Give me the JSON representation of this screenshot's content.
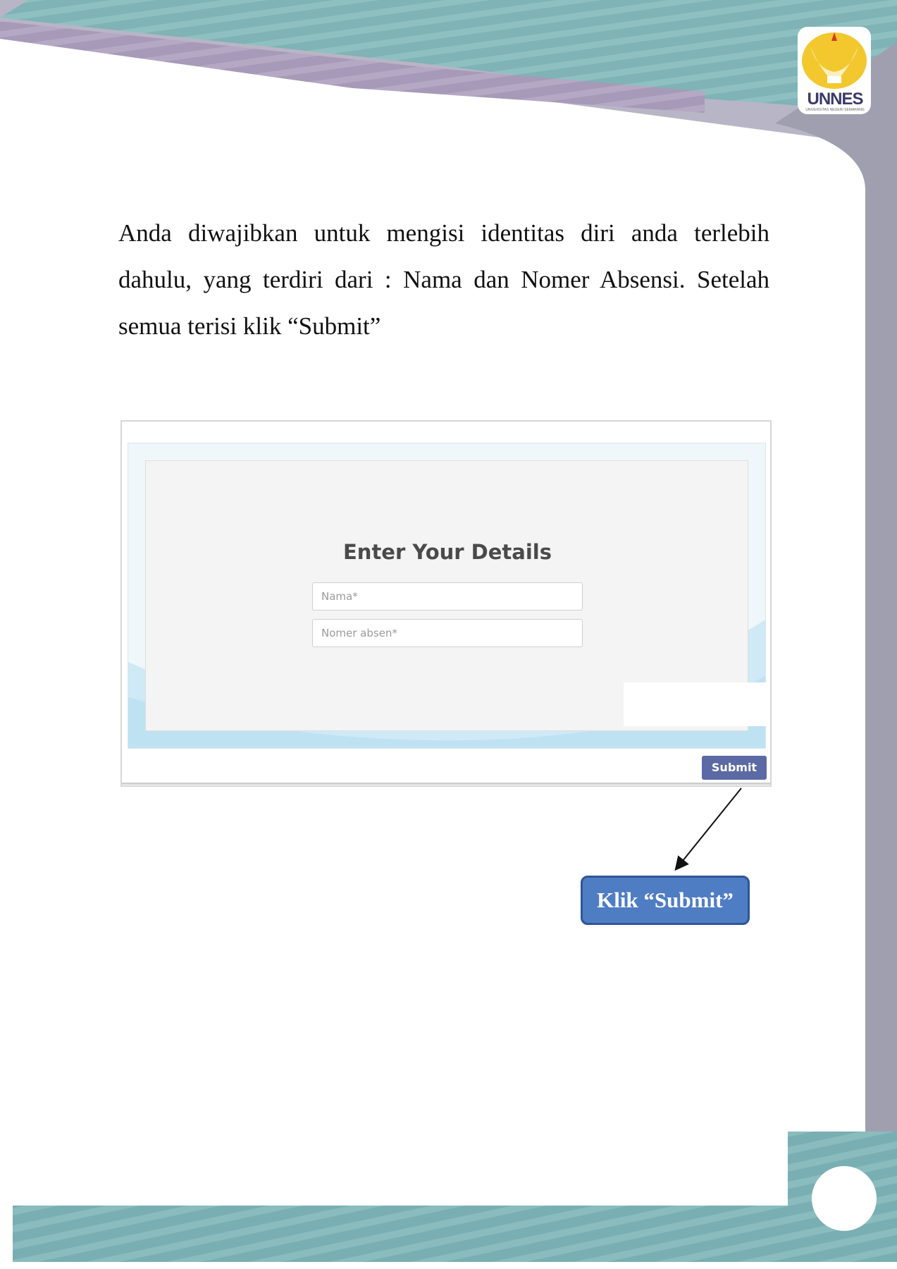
{
  "paragraph": "Anda diwajibkan untuk mengisi identitas diri anda terlebih dahulu, yang terdiri dari : Nama dan Nomer Absensi. Setelah semua terisi klik “Submit”",
  "logo": {
    "text": "UNNES",
    "subtext": "UNIVERSITAS NEGERI SEMARANG"
  },
  "form": {
    "title": "Enter Your Details",
    "fields": [
      {
        "placeholder": "Nama*"
      },
      {
        "placeholder": "Nomer absen*"
      }
    ],
    "submit_label": "Submit"
  },
  "callout": {
    "label": "Klik “Submit”"
  },
  "colors": {
    "teal": "#7fb3b5",
    "lavender": "#a79ab8",
    "gray_rail": "#a09fb0",
    "submit": "#5b6aa5",
    "callout": "#4f7dc3"
  }
}
